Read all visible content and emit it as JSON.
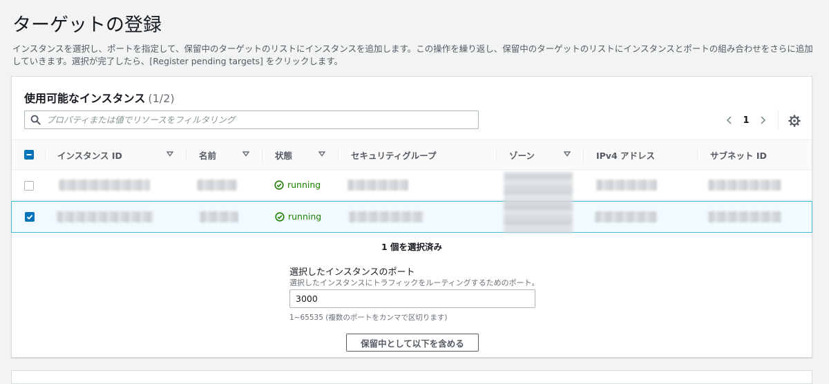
{
  "page": {
    "title": "ターゲットの登録",
    "description": "インスタンスを選択し、ポートを指定して、保留中のターゲットのリストにインスタンスを追加します。この操作を繰り返し、保留中のターゲットのリストにインスタンスとポートの組み合わせをさらに追加していきます。選択が完了したら、[Register pending targets] をクリックします。"
  },
  "instances_panel": {
    "title": "使用可能なインスタンス",
    "count": "(1/2)",
    "search_placeholder": "プロパティまたは値でリソースをフィルタリング",
    "page_number": "1",
    "columns": [
      "インスタンス ID",
      "名前",
      "状態",
      "セキュリティグループ",
      "ゾーン",
      "IPv4 アドレス",
      "サブネット ID"
    ],
    "rows": [
      {
        "selected": false,
        "status": "running"
      },
      {
        "selected": true,
        "status": "running"
      }
    ],
    "selected_count": "1 個を選択済み",
    "port_label": "選択したインスタンスのポート",
    "port_description": "選択したインスタンスにトラフィックをルーティングするためのポート。",
    "port_value": "3000",
    "port_hint": "1~65535 (複数のポートをカンマで区切ります)",
    "include_button": "保留中として以下を含める"
  },
  "colors": {
    "accent": "#0073bb",
    "running": "#1d8102",
    "selected_row_bg": "#f1faff",
    "selected_row_border": "#44b9d6"
  },
  "icons": {
    "search": "search-icon",
    "prev": "chevron-left-icon",
    "next": "chevron-right-icon",
    "settings": "gear-icon",
    "sort": "caret-down-icon",
    "status": "check-circle-icon"
  }
}
